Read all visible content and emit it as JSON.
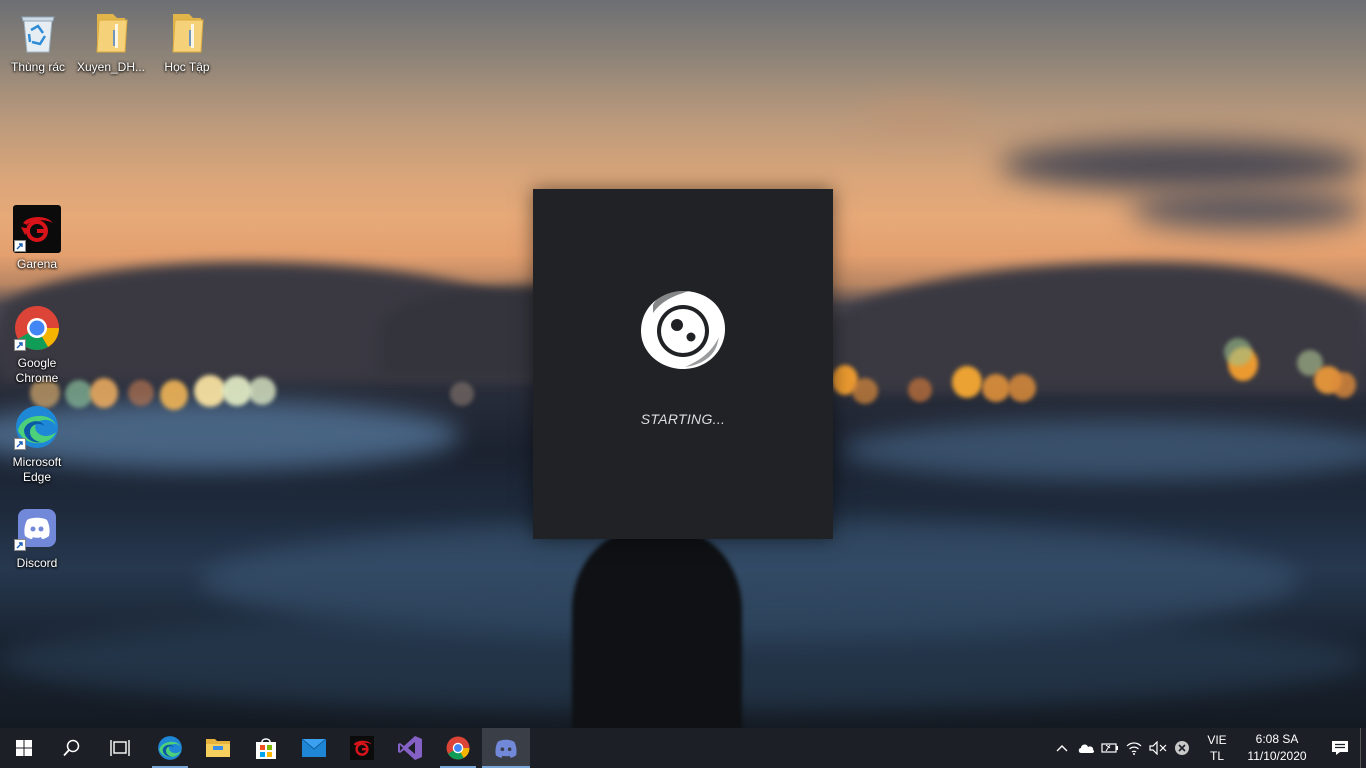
{
  "desktop": {
    "icons": [
      {
        "label": "Thùng rác",
        "icon": "recycle-bin-icon"
      },
      {
        "label": "Xuyen_DH...",
        "icon": "folder-icon"
      },
      {
        "label": "Học Tập",
        "icon": "folder-icon"
      },
      {
        "label": "Garena",
        "icon": "garena-icon"
      },
      {
        "label": "Google\nChrome",
        "icon": "chrome-icon"
      },
      {
        "label": "Microsoft\nEdge",
        "icon": "edge-icon"
      },
      {
        "label": "Discord",
        "icon": "discord-icon"
      }
    ]
  },
  "splash": {
    "app": "Discord",
    "status": "STARTING...",
    "background_color": "#202225"
  },
  "taskbar": {
    "apps": [
      {
        "name": "Start",
        "icon": "windows-icon"
      },
      {
        "name": "Search",
        "icon": "search-icon"
      },
      {
        "name": "Task View",
        "icon": "task-view-icon"
      },
      {
        "name": "Microsoft Edge",
        "icon": "edge-icon"
      },
      {
        "name": "File Explorer",
        "icon": "file-explorer-icon"
      },
      {
        "name": "Microsoft Store",
        "icon": "store-icon"
      },
      {
        "name": "Mail",
        "icon": "mail-icon"
      },
      {
        "name": "Garena",
        "icon": "garena-icon"
      },
      {
        "name": "Visual Studio",
        "icon": "visual-studio-icon"
      },
      {
        "name": "Google Chrome",
        "icon": "chrome-icon"
      },
      {
        "name": "Discord",
        "icon": "discord-icon",
        "active": true
      }
    ],
    "tray": {
      "icons": [
        "chevron-up-icon",
        "onedrive-icon",
        "battery-icon",
        "wifi-icon",
        "volume-muted-icon",
        "notification-close-icon"
      ],
      "language_line1": "VIE",
      "language_line2": "TL",
      "time": "6:08 SA",
      "date": "11/10/2020",
      "action_center_icon": "action-center-icon"
    },
    "accent_color": "#78a6d9"
  }
}
